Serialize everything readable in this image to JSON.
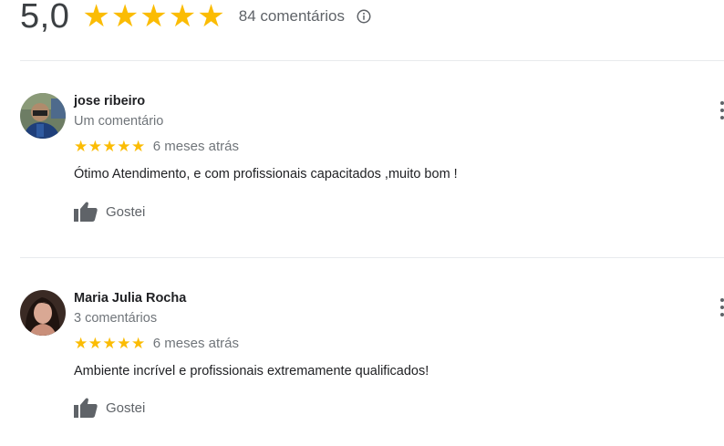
{
  "summary": {
    "score": "5,0",
    "stars": 5,
    "count_label": "84 comentários",
    "info_icon": "info-icon"
  },
  "reviews": [
    {
      "author": "jose ribeiro",
      "subtitle": "Um comentário",
      "rating": 5,
      "time": "6 meses atrás",
      "text": "Ótimo Atendimento, e com profissionais capacitados ,muito bom !",
      "like_label": "Gostei"
    },
    {
      "author": "Maria Julia Rocha",
      "subtitle": "3 comentários",
      "rating": 5,
      "time": "6 meses atrás",
      "text": "Ambiente incrível e profissionais extremamente qualificados!",
      "like_label": "Gostei"
    }
  ],
  "colors": {
    "star": "#fbbc04",
    "muted": "#70757a",
    "divider": "#e8eaed"
  }
}
